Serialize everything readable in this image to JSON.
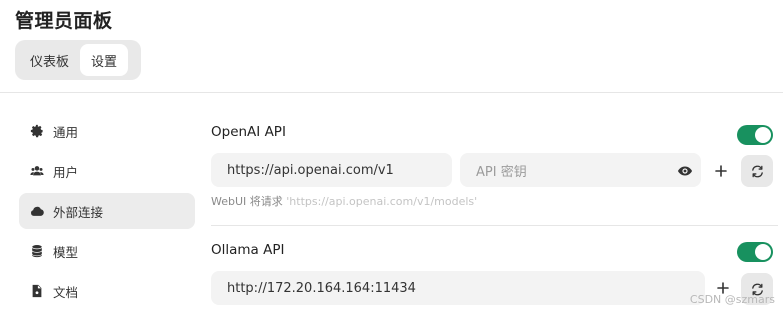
{
  "header": {
    "title": "管理员面板"
  },
  "tabs": [
    {
      "label": "仪表板",
      "active": false
    },
    {
      "label": "设置",
      "active": true
    }
  ],
  "sidebar": {
    "items": [
      {
        "label": "通用",
        "icon": "gear-icon",
        "active": false
      },
      {
        "label": "用户",
        "icon": "users-icon",
        "active": false
      },
      {
        "label": "外部连接",
        "icon": "cloud-icon",
        "active": true
      },
      {
        "label": "模型",
        "icon": "database-icon",
        "active": false
      },
      {
        "label": "文档",
        "icon": "document-icon",
        "active": false
      }
    ]
  },
  "openai": {
    "title": "OpenAI API",
    "enabled": true,
    "base_url": "https://api.openai.com/v1",
    "key_placeholder": "API 密钥",
    "hint_prefix": "WebUI 将请求",
    "hint_url": "'https://api.openai.com/v1/models'"
  },
  "ollama": {
    "title": "Ollama API",
    "enabled": true,
    "base_url": "http://172.20.164.164:11434"
  },
  "watermark": "CSDN @szmars",
  "colors": {
    "toggle_on": "#18915f",
    "active_bg": "#ececec",
    "field_bg": "#f3f3f3"
  }
}
